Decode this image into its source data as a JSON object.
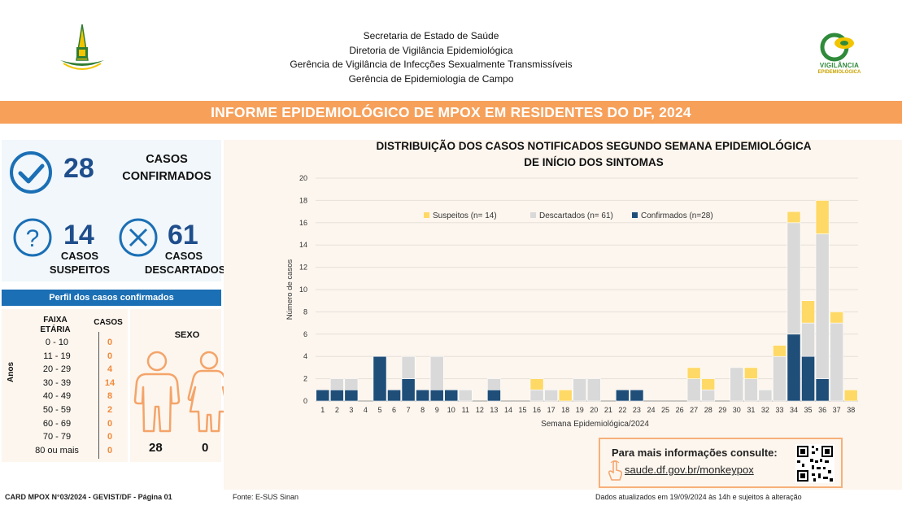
{
  "header": {
    "lines": [
      "Secretaria de Estado de Saúde",
      "Diretoria de Vigilância Epidemiológica",
      "Gerência de Vigilância de Infecções Sexualmente Transmissíveis",
      "Gerência de Epidemiologia de Campo"
    ],
    "logo_right_line1": "VIGILÂNCIA",
    "logo_right_line2": "EPIDEMIOLÓGICA"
  },
  "banner": "INFORME EPIDEMIOLÓGICO DE MPOX EM RESIDENTES DO DF, 2024",
  "kpis": {
    "confirmed": {
      "value": "28",
      "label": "CASOS CONFIRMADOS",
      "icon": "check-circle-icon"
    },
    "suspected": {
      "value": "14",
      "label": "CASOS SUSPEITOS",
      "icon": "question-circle-icon"
    },
    "discarded": {
      "value": "61",
      "label": "CASOS DESCARTADOS",
      "icon": "x-circle-icon"
    }
  },
  "profile": {
    "title": "Perfil dos casos confirmados",
    "age_header": "FAIXA ETÁRIA",
    "cases_header": "CASOS",
    "axis_label": "Anos",
    "age_groups": [
      {
        "label": "0 - 10",
        "value": "0"
      },
      {
        "label": "11 - 19",
        "value": "0"
      },
      {
        "label": "20 - 29",
        "value": "4"
      },
      {
        "label": "30 - 39",
        "value": "14"
      },
      {
        "label": "40 - 49",
        "value": "8"
      },
      {
        "label": "50 - 59",
        "value": "2"
      },
      {
        "label": "60 - 69",
        "value": "0"
      },
      {
        "label": "70 - 79",
        "value": "0"
      },
      {
        "label": "80 ou mais",
        "value": "0"
      }
    ],
    "sex_header": "SEXO",
    "male": "28",
    "female": "0"
  },
  "chart_data": {
    "type": "bar",
    "stacked": true,
    "title": "DISTRIBUIÇÃO DOS CASOS NOTIFICADOS SEGUNDO SEMANA EPIDEMIOLÓGICA DE INÍCIO DOS SINTOMAS",
    "title_lines": [
      "DISTRIBUIÇÃO DOS CASOS NOTIFICADOS SEGUNDO SEMANA EPIDEMIOLÓGICA",
      "DE INÍCIO DOS SINTOMAS"
    ],
    "xlabel": "Semana Epidemiológica/2024",
    "ylabel": "Número de casos",
    "ylim": [
      0,
      20
    ],
    "yticks": [
      0,
      2,
      4,
      6,
      8,
      10,
      12,
      14,
      16,
      18,
      20
    ],
    "grid": true,
    "legend_position": "top",
    "categories": [
      "1",
      "2",
      "3",
      "4",
      "5",
      "6",
      "7",
      "8",
      "9",
      "10",
      "11",
      "12",
      "13",
      "14",
      "15",
      "16",
      "17",
      "18",
      "19",
      "20",
      "21",
      "22",
      "23",
      "24",
      "25",
      "26",
      "27",
      "28",
      "29",
      "30",
      "31",
      "32",
      "33",
      "34",
      "35",
      "36",
      "37",
      "38"
    ],
    "series": [
      {
        "name": "Confirmados (n=28)",
        "color": "#1f4e79",
        "values": [
          1,
          1,
          1,
          0,
          4,
          1,
          2,
          1,
          1,
          1,
          0,
          0,
          1,
          0,
          0,
          0,
          0,
          0,
          0,
          0,
          0,
          1,
          1,
          0,
          0,
          0,
          0,
          0,
          0,
          0,
          0,
          0,
          0,
          6,
          4,
          2,
          0,
          0
        ]
      },
      {
        "name": "Descartados (n= 61)",
        "color": "#d9d9d9",
        "values": [
          0,
          1,
          1,
          0,
          0,
          0,
          2,
          0,
          3,
          0,
          1,
          0,
          1,
          0,
          0,
          1,
          1,
          0,
          2,
          2,
          0,
          0,
          0,
          0,
          0,
          0,
          2,
          1,
          0,
          3,
          2,
          1,
          4,
          10,
          3,
          13,
          7,
          0
        ]
      },
      {
        "name": "Suspeitos (n= 14)",
        "color": "#ffd966",
        "values": [
          0,
          0,
          0,
          0,
          0,
          0,
          0,
          0,
          0,
          0,
          0,
          0,
          0,
          0,
          0,
          1,
          0,
          1,
          0,
          0,
          0,
          0,
          0,
          0,
          0,
          0,
          1,
          1,
          0,
          0,
          1,
          0,
          1,
          1,
          2,
          3,
          1,
          1
        ]
      }
    ],
    "legend_order": [
      "Suspeitos (n= 14)",
      "Descartados (n= 61)",
      "Confirmados (n=28)"
    ]
  },
  "info": {
    "title": "Para mais informações consulte:",
    "link": "saude.df.gov.br/monkeypox"
  },
  "footer": {
    "card": "CARD MPOX N°03/2024 - GEVIST/DF - Página 01",
    "source": "Fonte: E-SUS Sinan",
    "updated": "Dados atualizados em 19/09/2024 às 14h e sujeitos à alteração"
  }
}
